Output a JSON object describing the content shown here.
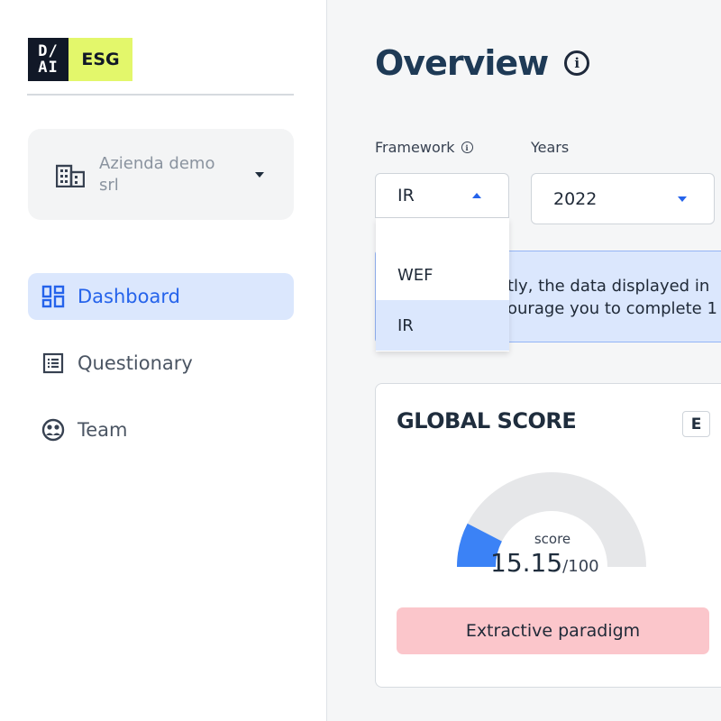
{
  "logo": {
    "mark_top": "D/",
    "mark_bottom": "AI",
    "product": "ESG"
  },
  "company": {
    "name": "Azienda demo srl",
    "icon": "building-icon"
  },
  "nav": {
    "items": [
      {
        "label": "Dashboard",
        "icon": "dashboard-icon",
        "active": true
      },
      {
        "label": "Questionary",
        "icon": "list-icon",
        "active": false
      },
      {
        "label": "Team",
        "icon": "team-icon",
        "active": false
      }
    ]
  },
  "header": {
    "title": "Overview"
  },
  "filters": {
    "framework_label": "Framework",
    "framework_value": "IR",
    "years_label": "Years",
    "years_value": "2022",
    "framework_options": [
      "WEF",
      "IR"
    ],
    "selected_option": "IR"
  },
  "alert": {
    "line1": "tly, the data displayed in",
    "line2": "ourage you to complete 1"
  },
  "score_card": {
    "title": "GLOBAL SCORE",
    "grade": "E",
    "score_label": "score",
    "score_value": "15.15",
    "score_max": "/100",
    "score_fraction": 0.1515,
    "status": "Extractive paradigm",
    "colors": {
      "fill": "#3b82f6",
      "track": "#e6e7e9",
      "status_bg": "#fbc6cb"
    }
  },
  "colors": {
    "accent": "#2563eb",
    "brand_highlight": "#e3f76b",
    "active_bg": "#dbe7fd"
  }
}
